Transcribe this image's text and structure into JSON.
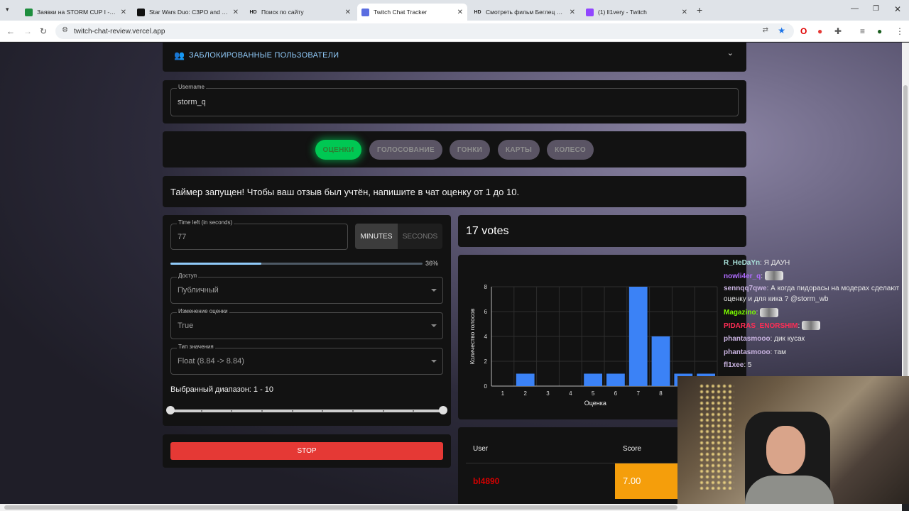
{
  "browser": {
    "tabs": [
      {
        "title": "Заявки на STORM CUP I - Goo",
        "fav": "sheets-icon",
        "fav_color": "#1e8e3e",
        "active": false
      },
      {
        "title": "Star Wars Duo: C3PO and R2D2",
        "fav": "tiktok-icon",
        "fav_color": "#111111",
        "active": false
      },
      {
        "title": "Поиск по сайту",
        "fav": "hd-icon",
        "fav_color": "#222222",
        "active": false
      },
      {
        "title": "Twitch Chat Tracker",
        "fav": "app-icon",
        "fav_color": "#5b6ee1",
        "active": true
      },
      {
        "title": "Смотреть фильм Беглец онлайн",
        "fav": "hd-icon",
        "fav_color": "#222222",
        "active": false
      },
      {
        "title": "(1) ll1very - Twitch",
        "fav": "twitch-icon",
        "fav_color": "#9146ff",
        "active": false
      }
    ],
    "url": "twitch-chat-review.vercel.app",
    "fav_labels": {
      "hd": "HD"
    }
  },
  "blocked": {
    "title": "ЗАБЛОКИРОВАННЫЕ ПОЛЬЗОВАТЕЛИ"
  },
  "username": {
    "label": "Username",
    "value": "storm_q"
  },
  "modes": [
    {
      "label": "ОЦЕНКИ",
      "active": true
    },
    {
      "label": "ГОЛОСОВАНИЕ",
      "active": false
    },
    {
      "label": "ГОНКИ",
      "active": false
    },
    {
      "label": "КАРТЫ",
      "active": false
    },
    {
      "label": "КОЛЕСО",
      "active": false
    }
  ],
  "banner": "Таймер запущен! Чтобы ваш отзыв был учтён, напишите в чат оценку от 1 до 10.",
  "timer": {
    "label": "Time left (in seconds)",
    "value": "77",
    "minutes": "MINUTES",
    "seconds": "SECONDS",
    "progress_text": "36%",
    "progress": 0.36
  },
  "access": {
    "label": "Доступ",
    "value": "Публичный"
  },
  "change": {
    "label": "Изменение оценки",
    "value": "True"
  },
  "valtype": {
    "label": "Тип значения",
    "value": "Float (8.84 -> 8.84)"
  },
  "range": {
    "label": "Выбранный диапазон: 1 - 10",
    "min": 1,
    "max": 10
  },
  "stop": "STOP",
  "votes": "17 votes",
  "chart_data": {
    "type": "bar",
    "categories": [
      "1",
      "2",
      "3",
      "4",
      "5",
      "6",
      "7",
      "8",
      "9",
      "10"
    ],
    "values": [
      0,
      1,
      0,
      0,
      1,
      1,
      8,
      4,
      1,
      1
    ],
    "xlabel": "Оценка",
    "ylabel": "Количество голосов",
    "ylim": [
      0,
      8
    ],
    "yticks": [
      "0",
      "2",
      "4",
      "6",
      "8"
    ],
    "visible_xticks": [
      "1",
      "2",
      "3",
      "4",
      "5",
      "6",
      "7",
      "8"
    ],
    "bar_color": "#3b82f6",
    "grid": true
  },
  "table": {
    "headers": [
      "User",
      "Score"
    ],
    "rows": [
      {
        "user": "bl4890",
        "score": "7.00"
      }
    ]
  },
  "chat": [
    {
      "user": "R_HeDaYn",
      "color": "#a8e0d8",
      "text": "Я ДАУН"
    },
    {
      "user": "nowli4er_q",
      "color": "#b06cff",
      "text": "",
      "emote": true
    },
    {
      "user": "sennqq7qwe",
      "color": "#c9b3e0",
      "text": "А когда пидорасы на модерах сделают оценку и для кика ? @storm_wb"
    },
    {
      "user": "Magazino",
      "color": "#7cfc00",
      "text": "",
      "emote": true
    },
    {
      "user": "PIDARAS_ENORSHIM",
      "color": "#ff2d55",
      "text": "",
      "emote": true
    },
    {
      "user": "phantasmooo",
      "color": "#c9b3e0",
      "text": "дик кусак"
    },
    {
      "user": "phantasmooo",
      "color": "#c9b3e0",
      "text": "там"
    },
    {
      "user": "fl1xee",
      "color": "#c9b3e0",
      "text": "5"
    }
  ]
}
